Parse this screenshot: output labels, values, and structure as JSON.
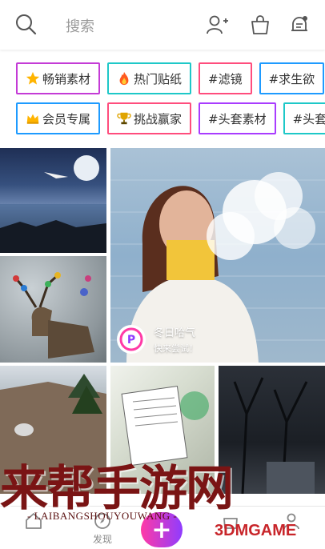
{
  "topbar": {
    "search_placeholder": "搜索",
    "icons": [
      "search-icon",
      "add-user-icon",
      "shopping-bag-icon",
      "notification-bell-icon"
    ]
  },
  "tags": {
    "row1": [
      {
        "label": "畅销素材",
        "icon": "star-icon",
        "color": "#c43bd6"
      },
      {
        "label": "热门贴纸",
        "icon": "fire-icon",
        "color": "#1ec8c8"
      },
      {
        "label": "#滤镜",
        "icon": "",
        "color": "#ff4d7d"
      },
      {
        "label": "#求生欲",
        "icon": "",
        "color": "#1e9bff"
      },
      {
        "label": "#",
        "icon": "",
        "color": "#ffb32c"
      }
    ],
    "row2": [
      {
        "label": "会员专属",
        "icon": "crown-icon",
        "color": "#1e9bff"
      },
      {
        "label": "挑战赢家",
        "icon": "trophy-icon",
        "color": "#ff4d7d"
      },
      {
        "label": "#头套素材",
        "icon": "",
        "color": "#a93cff"
      },
      {
        "label": "#头套",
        "icon": "",
        "color": "#1ec8c8"
      }
    ]
  },
  "feature": {
    "title": "冬日哈气",
    "subtitle": "快来尝试！",
    "logo_letter": "P"
  },
  "watermark": {
    "title": "来帮手游网",
    "subtitle": "- LAIBANGSHOUYOUWANG -",
    "brand": "3DMGAME"
  },
  "bottom_nav": {
    "home_label": "",
    "discover_label": "发现",
    "create_label": "+",
    "shop_label": "",
    "profile_label": ""
  },
  "colors": {
    "accent_pink": "#ff3aa6",
    "accent_purple": "#8f3cff"
  }
}
